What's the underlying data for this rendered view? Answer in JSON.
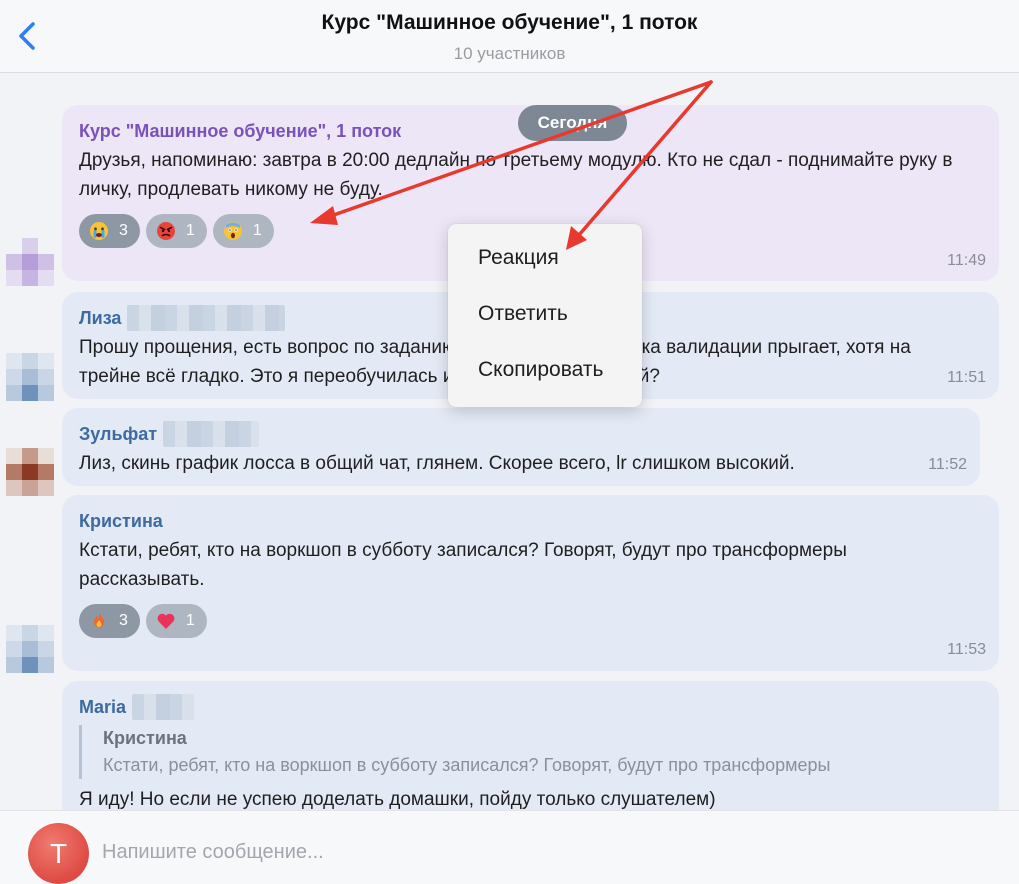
{
  "header": {
    "title": "Курс \"Машинное обучение\", 1 поток",
    "subtitle": "10 участников",
    "back_icon": "chevron-left-icon"
  },
  "feed": {
    "date_label": "Сегодня",
    "messages": [
      {
        "sender": "Курс \"Машинное обучение\", 1 поток",
        "text": "Друзья, напоминаю: завтра в 20:00 дедлайн по третьему модулю. Кто не сдал - поднимайте руку в личку, продлевать никому не буду.",
        "time": "11:49",
        "reactions": [
          {
            "emoji": "crying-face-icon",
            "count": "3"
          },
          {
            "emoji": "angry-face-icon",
            "count": "1"
          },
          {
            "emoji": "screaming-face-icon",
            "count": "1"
          }
        ]
      },
      {
        "sender": "Лиза",
        "text": "Прошу прощения, есть вопрос по заданию: на валидации ошибка валидации прыгает, хотя на трейне всё гладко. Это я переобучилась или датасет маленький?",
        "time": "11:51"
      },
      {
        "sender": "Зульфат",
        "text": "Лиз, скинь график лосса в общий чат, глянем. Скорее всего, lr слишком высокий.",
        "time": "11:52"
      },
      {
        "sender": "Кристина",
        "text": "Кстати, ребят, кто на воркшоп в субботу записался? Говорят, будут про трансформеры рассказывать.",
        "time": "11:53",
        "reactions": [
          {
            "emoji": "fire-icon",
            "count": "3"
          },
          {
            "emoji": "heart-icon",
            "count": "1"
          }
        ]
      },
      {
        "sender": "Maria",
        "quote": {
          "author": "Кристина",
          "text": "Кстати, ребят, кто на воркшоп в субботу записался? Говорят, будут про трансформеры"
        },
        "text": "Я иду! Но если не успею доделать домашки, пойду только слушателем)"
      }
    ]
  },
  "context_menu": {
    "items": [
      "Реакция",
      "Ответить",
      "Скопировать"
    ]
  },
  "composer": {
    "avatar_letter": "Т",
    "placeholder": "Напишите сообщение..."
  },
  "colors": {
    "accent": "#2f80ed",
    "own_bubble": "#ece6f7",
    "bubble": "#e3eaf5",
    "arrow": "#e8392e",
    "avatar": "#de4b43"
  }
}
